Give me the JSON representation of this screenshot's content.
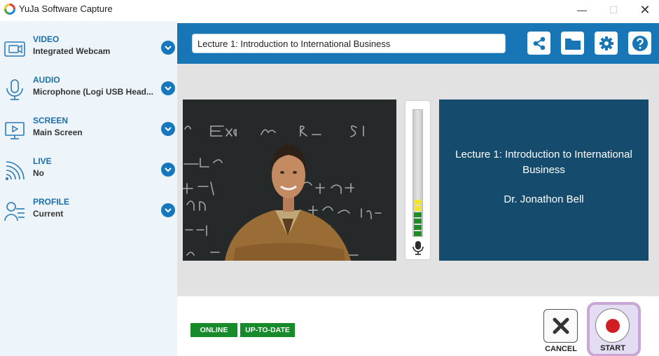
{
  "window": {
    "title": "YuJa Software Capture",
    "minimize_glyph": "—",
    "maximize_glyph": "☐",
    "close_glyph": "✕"
  },
  "sidebar": {
    "items": [
      {
        "title": "VIDEO",
        "value": "Integrated Webcam",
        "icon": "webcam-icon"
      },
      {
        "title": "AUDIO",
        "value": "Microphone (Logi USB Head...",
        "icon": "microphone-icon"
      },
      {
        "title": "SCREEN",
        "value": "Main Screen",
        "icon": "screen-icon"
      },
      {
        "title": "LIVE",
        "value": "No",
        "icon": "live-broadcast-icon"
      },
      {
        "title": "PROFILE",
        "value": "Current",
        "icon": "profile-icon"
      }
    ]
  },
  "toolbar": {
    "session_title": "Lecture 1: Introduction to International Business",
    "buttons": [
      "share-icon",
      "folder-icon",
      "gear-icon",
      "help-icon"
    ]
  },
  "preview": {
    "slide_title": "Lecture 1: Introduction to International Business",
    "slide_author": "Dr. Jonathon Bell"
  },
  "status": {
    "connection": "ONLINE",
    "update": "UP-TO-DATE"
  },
  "actions": {
    "cancel_label": "CANCEL",
    "start_label": "START"
  },
  "colors": {
    "accent_blue": "#1876b7",
    "sidebar_bg": "#edf5fb",
    "slide_bg": "#154c6e",
    "status_green": "#178a2a",
    "record_red": "#d11e24",
    "start_highlight": "#c9a6d6"
  }
}
